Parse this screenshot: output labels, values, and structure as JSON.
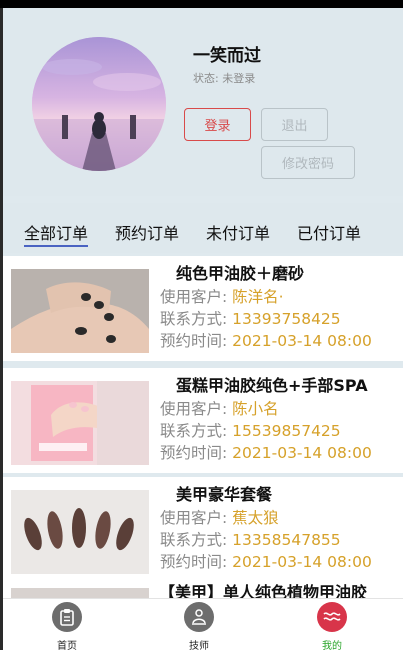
{
  "profile": {
    "username": "一笑而过",
    "status_label": "状态:",
    "status_value": "未登录",
    "login_button": "登录",
    "logout_button": "退出",
    "change_password_button": "修改密码"
  },
  "tabs": [
    {
      "label": "全部订单",
      "active": true
    },
    {
      "label": "预约订单",
      "active": false
    },
    {
      "label": "未付订单",
      "active": false
    },
    {
      "label": "已付订单",
      "active": false
    }
  ],
  "field_labels": {
    "customer": "使用客户:",
    "contact": "联系方式:",
    "time": "预约时间:"
  },
  "orders": [
    {
      "title": "纯色甲油胶＋磨砂",
      "customer": "陈洋名·",
      "phone": "13393758425",
      "time": "2021-03-14 08:00"
    },
    {
      "title": "蛋糕甲油胶纯色+手部SPA",
      "customer": "陈小名",
      "phone": "15539857425",
      "time": "2021-03-14 08:00"
    },
    {
      "title": "美甲豪华套餐",
      "customer": "蕉太狼",
      "phone": "13358547855",
      "time": "2021-03-14 08:00"
    },
    {
      "title": "【美甲】单人纯色植物甲油胶"
    }
  ],
  "bottom_nav": [
    {
      "label": "首页",
      "icon": "clipboard-icon",
      "active": false
    },
    {
      "label": "技师",
      "icon": "technician-icon",
      "active": false
    },
    {
      "label": "我的",
      "icon": "profile-wave-icon",
      "active": true
    }
  ],
  "colors": {
    "accent_value": "#d6a12a",
    "login_red": "#d84a4a",
    "active_tab_underline": "#4a63c2",
    "active_nav": "#2aa52a",
    "background": "#dee8ed"
  }
}
